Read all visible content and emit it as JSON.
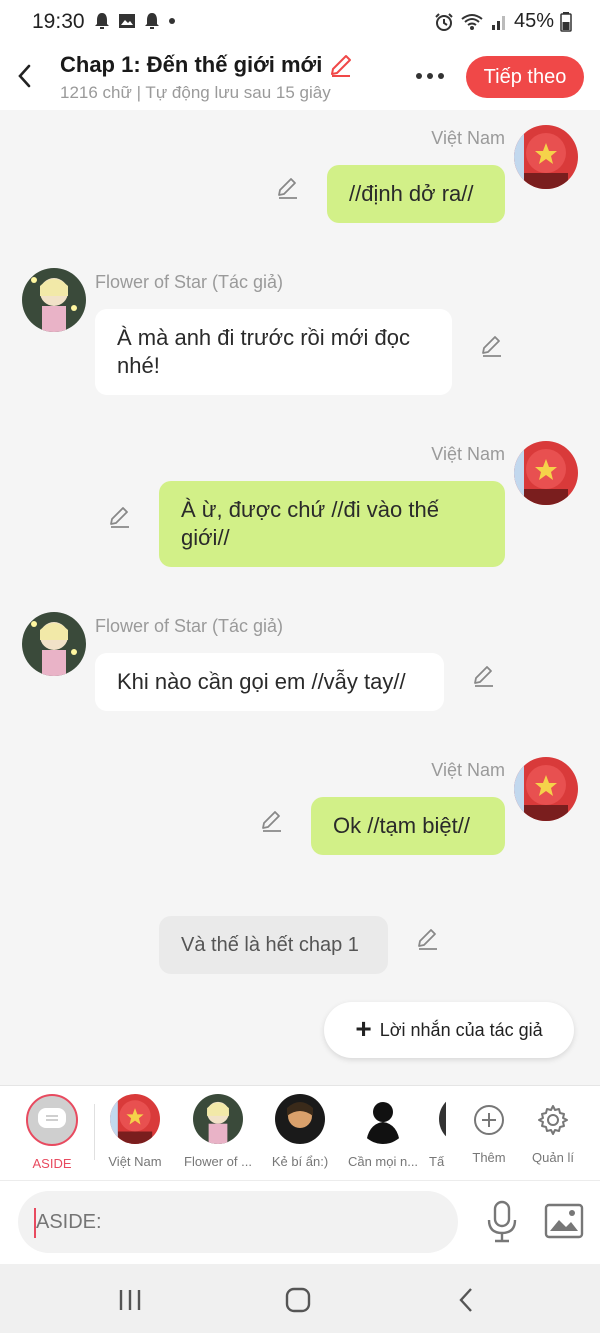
{
  "status": {
    "time": "19:30",
    "battery": "45%"
  },
  "header": {
    "title": "Chap 1: Đến thế giới mới",
    "subtitle": "1216 chữ | Tự động lưu sau 15 giây",
    "next_label": "Tiếp theo"
  },
  "messages": [
    {
      "speaker": "Việt Nam",
      "text": "//định dở ra//",
      "side": "right"
    },
    {
      "speaker": "Flower of Star (Tác giả)",
      "text": "À mà anh đi trước rồi mới đọc nhé!",
      "side": "left"
    },
    {
      "speaker": "Việt Nam",
      "text": "À ừ, được chứ //đi vào thế giới//",
      "side": "right"
    },
    {
      "speaker": "Flower of Star (Tác giả)",
      "text": "Khi nào cần gọi em //vẫy tay//",
      "side": "left"
    },
    {
      "speaker": "Việt Nam",
      "text": "Ok //tạm biệt//",
      "side": "right"
    }
  ],
  "narration": "Và thế là hết chap 1",
  "author_note_label": "Lời nhắn của tác giả",
  "characters": {
    "aside": "ASIDE",
    "items": [
      "Việt Nam",
      "Flower of ...",
      "Kẻ bí ẩn:)",
      "Cần mọi n...",
      "Tấ"
    ],
    "add": "Thêm",
    "manage": "Quản lí"
  },
  "input": {
    "placeholder": "ASIDE:"
  },
  "colors": {
    "accent": "#f04848",
    "bubble_green": "#d2f088",
    "aside": "#e84a5f"
  }
}
